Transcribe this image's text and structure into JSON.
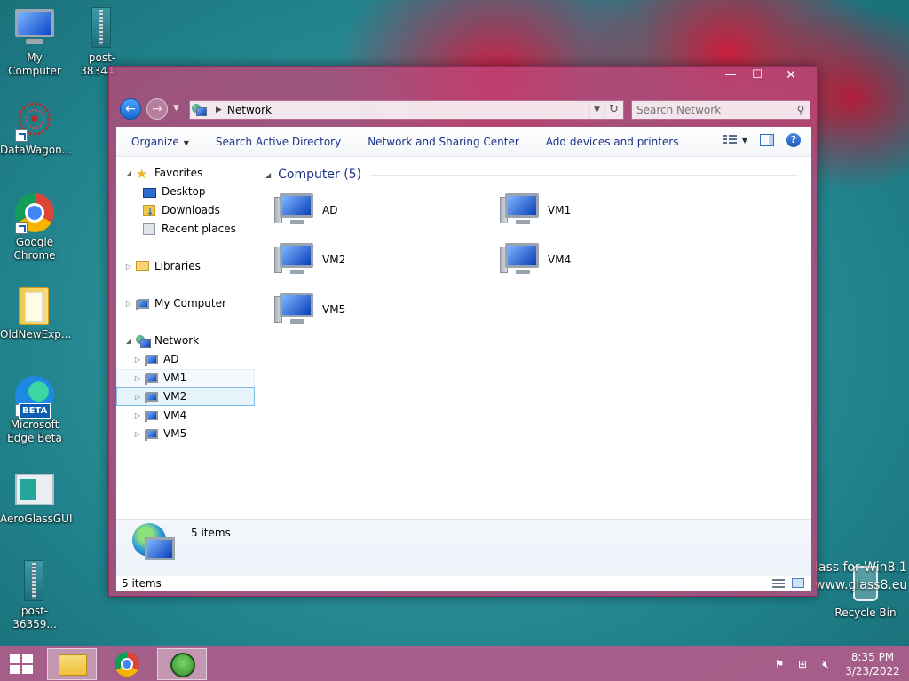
{
  "desktop": {
    "icons": [
      {
        "label": "My Computer",
        "icon": "computer-icon"
      },
      {
        "label": "post-38344...",
        "icon": "zip-archive-icon"
      },
      {
        "label": "DataWagon...",
        "icon": "datawagon-icon"
      },
      {
        "label": "Google Chrome",
        "icon": "chrome-icon"
      },
      {
        "label": "OldNewExp...",
        "icon": "folder-icon"
      },
      {
        "label": "Microsoft Edge Beta",
        "icon": "edge-beta-icon",
        "badge": "BETA"
      },
      {
        "label": "AeroGlassGUI",
        "icon": "aeroglass-icon"
      },
      {
        "label": "post-36359...",
        "icon": "zip-archive-icon"
      },
      {
        "label": "Recycle Bin",
        "icon": "recycle-bin-icon"
      }
    ],
    "watermark_line1": "lass for Win8.1",
    "watermark_line2": "www.glass8.eu"
  },
  "window": {
    "caption_buttons": {
      "minimize": "—",
      "maximize": "☐",
      "close": "✕"
    },
    "address": {
      "location": "Network"
    },
    "search": {
      "placeholder": "Search Network"
    },
    "toolbar": {
      "organize": "Organize",
      "search_ad": "Search Active Directory",
      "network_sharing": "Network and Sharing Center",
      "add_devices": "Add devices and printers"
    },
    "tree": {
      "favorites": "Favorites",
      "desktop": "Desktop",
      "downloads": "Downloads",
      "recent": "Recent places",
      "libraries": "Libraries",
      "my_computer": "My Computer",
      "network": "Network",
      "network_children": [
        "AD",
        "VM1",
        "VM2",
        "VM4",
        "VM5"
      ],
      "selected": "VM2"
    },
    "content": {
      "group_title": "Computer (5)",
      "items": [
        "AD",
        "VM1",
        "VM2",
        "VM4",
        "VM5"
      ]
    },
    "details": {
      "count": "5 items"
    },
    "status": {
      "text": "5 items"
    }
  },
  "taskbar": {
    "apps": [
      {
        "name": "File Explorer",
        "active": true
      },
      {
        "name": "Google Chrome",
        "active": false
      },
      {
        "name": "Frog app",
        "active": true
      }
    ],
    "clock": {
      "time": "8:35 PM",
      "date": "3/23/2022"
    }
  }
}
